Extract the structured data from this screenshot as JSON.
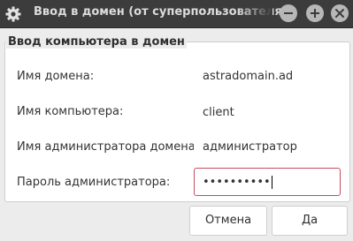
{
  "window": {
    "title": "Ввод в домен (от суперпользователя)",
    "icon": "settings-gear-icon",
    "controls": [
      "minimize-icon",
      "maximize-icon",
      "close-icon"
    ]
  },
  "form": {
    "group_title": "Ввод компьютера в домен",
    "fields": [
      {
        "label": "Имя домена:",
        "value": "astradomain.ad"
      },
      {
        "label": "Имя компьютера:",
        "value": "client"
      },
      {
        "label": "Имя администратора домена:",
        "value": "администратор"
      },
      {
        "label": "Пароль администратора:",
        "value": "••••••••••"
      }
    ]
  },
  "buttons": {
    "cancel": "Отмена",
    "ok": "Да"
  },
  "colors": {
    "titlebar": "#3c3c3c",
    "focus_border": "#c84d5d"
  }
}
